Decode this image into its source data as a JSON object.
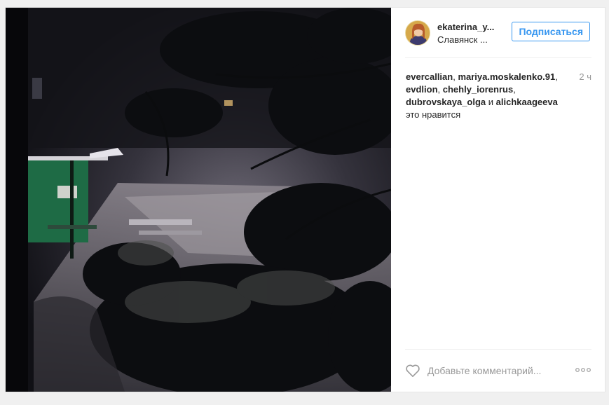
{
  "post": {
    "image_alt": "",
    "user": {
      "username": "ekaterina_y...",
      "location": "Славянск ...",
      "follow_label": "Подписаться"
    },
    "likes": {
      "names": [
        "evercallian",
        "mariya.moskalenko.91",
        "evdlion",
        "chehly_iorenrus",
        "dubrovskaya_olga"
      ],
      "separator": ", ",
      "connector": " и ",
      "last_name": "alichkaageeva",
      "suffix": "это нравится"
    },
    "time": "2 ч",
    "comment": {
      "placeholder": "Добавьте комментарий...",
      "value": ""
    },
    "icons": {
      "like": "heart-icon",
      "more": "more-options-icon"
    },
    "colors": {
      "accent": "#3897f0",
      "text": "#262626",
      "muted": "#999999"
    }
  }
}
